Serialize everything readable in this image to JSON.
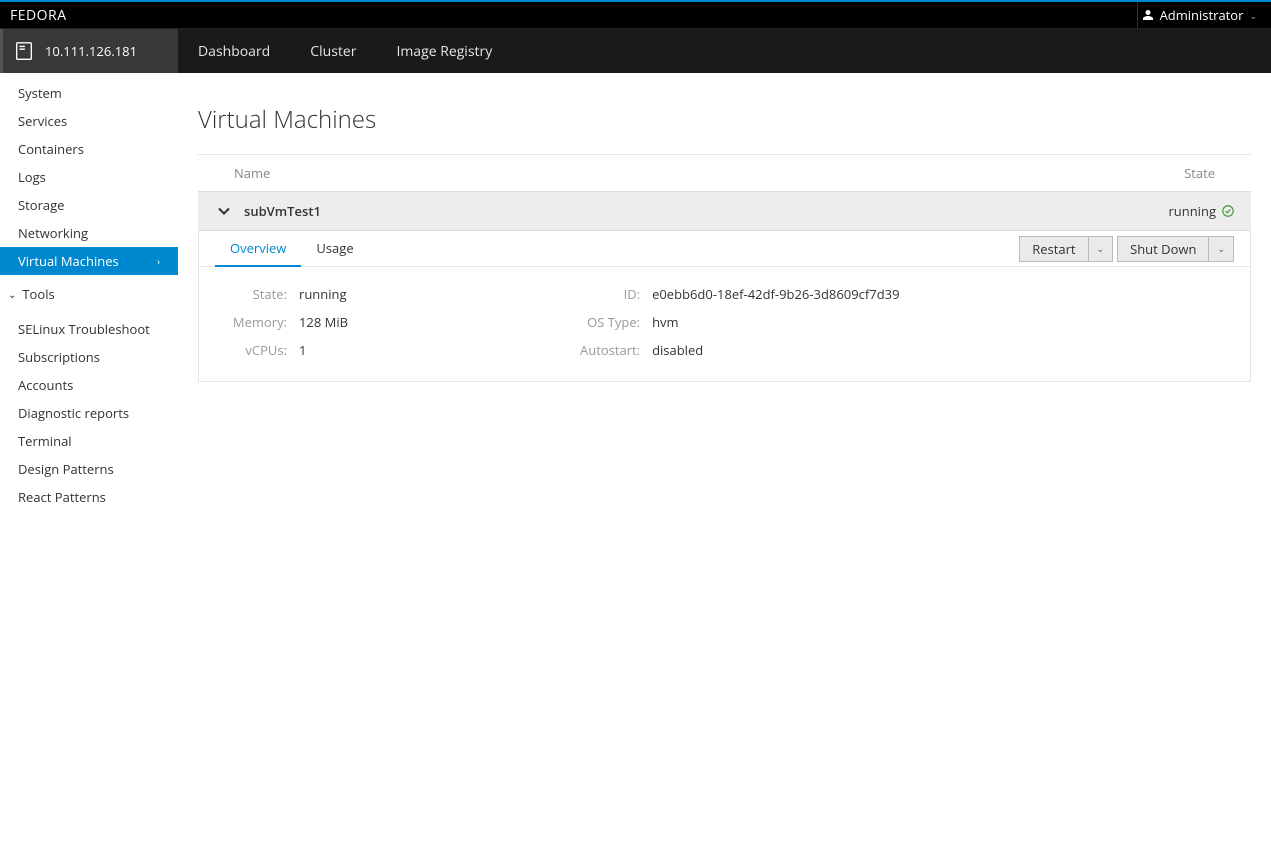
{
  "brand": "FEDORA",
  "user": {
    "name": "Administrator"
  },
  "host": {
    "ip": "10.111.126.181"
  },
  "topnav": {
    "dashboard": "Dashboard",
    "cluster": "Cluster",
    "image_registry": "Image Registry"
  },
  "sidebar": {
    "items": [
      {
        "label": "System"
      },
      {
        "label": "Services"
      },
      {
        "label": "Containers"
      },
      {
        "label": "Logs"
      },
      {
        "label": "Storage"
      },
      {
        "label": "Networking"
      },
      {
        "label": "Virtual Machines",
        "active": true
      }
    ],
    "tools_label": "Tools",
    "tools": [
      {
        "label": "SELinux Troubleshoot"
      },
      {
        "label": "Subscriptions"
      },
      {
        "label": "Accounts"
      },
      {
        "label": "Diagnostic reports"
      },
      {
        "label": "Terminal"
      },
      {
        "label": "Design Patterns"
      },
      {
        "label": "React Patterns"
      }
    ]
  },
  "page": {
    "title": "Virtual Machines",
    "columns": {
      "name": "Name",
      "state": "State"
    }
  },
  "vm": {
    "name": "subVmTest1",
    "state_text": "running",
    "tabs": {
      "overview": "Overview",
      "usage": "Usage"
    },
    "actions": {
      "restart": "Restart",
      "shutdown": "Shut Down"
    },
    "details": {
      "labels": {
        "state": "State:",
        "memory": "Memory:",
        "vcpus": "vCPUs:",
        "id": "ID:",
        "os_type": "OS Type:",
        "autostart": "Autostart:"
      },
      "state": "running",
      "memory": "128 MiB",
      "vcpus": "1",
      "id": "e0ebb6d0-18ef-42df-9b26-3d8609cf7d39",
      "os_type": "hvm",
      "autostart": "disabled"
    }
  }
}
